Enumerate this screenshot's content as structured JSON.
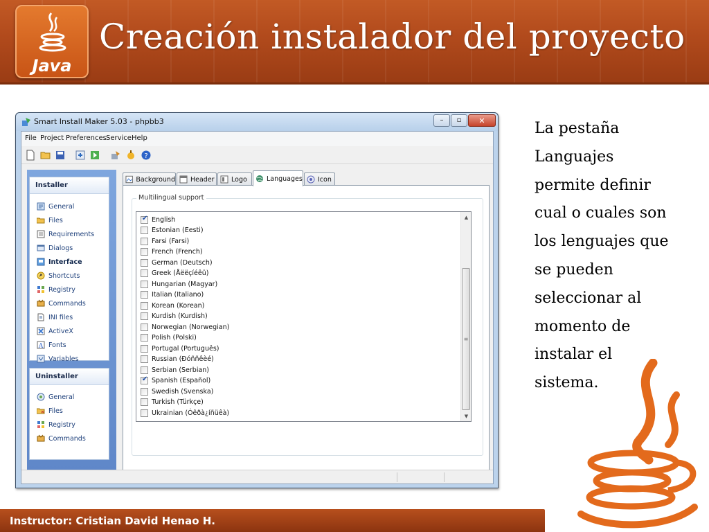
{
  "slide": {
    "title": "Creación instalador del proyecto",
    "logo_text": "Java",
    "footer": "Instructor: Cristian David Henao H.",
    "description_lines": [
      "La pestaña",
      "Languajes",
      "permite definir",
      "cual  o cuales son",
      "los lenguajes que",
      "se pueden",
      "seleccionar al",
      "momento de",
      "instalar el",
      "sistema."
    ],
    "colors": {
      "header": "#b14a1c",
      "footer": "#9a3c14",
      "java_orange": "#e36a1c"
    }
  },
  "window": {
    "title": "Smart Install Maker 5.03 - phpbb3",
    "controls": {
      "minimize": "–",
      "maximize": "▫",
      "close": "✕"
    },
    "menu": [
      "File",
      "Project",
      "Preferences",
      "Service",
      "Help"
    ],
    "toolbar_icons": [
      "new-file-icon",
      "open-folder-icon",
      "save-icon",
      "build-icon",
      "run-icon",
      "settings-icon",
      "wizard-icon",
      "help-icon"
    ],
    "installer": {
      "heading": "Installer",
      "items": [
        "General",
        "Files",
        "Requirements",
        "Dialogs",
        "Interface",
        "Shortcuts",
        "Registry",
        "Commands",
        "INI files",
        "ActiveX",
        "Fonts",
        "Variables"
      ],
      "active": "Interface"
    },
    "uninstaller": {
      "heading": "Uninstaller",
      "items": [
        "General",
        "Files",
        "Registry",
        "Commands"
      ]
    },
    "tabs": [
      "Background",
      "Header",
      "Logo",
      "Languages",
      "Icon"
    ],
    "active_tab": "Languages",
    "group_label": "Multilingual support",
    "languages": [
      {
        "name": "English",
        "checked": true
      },
      {
        "name": "Estonian (Eesti)",
        "checked": false
      },
      {
        "name": "Farsi (Farsi)",
        "checked": false
      },
      {
        "name": "French (French)",
        "checked": false
      },
      {
        "name": "German (Deutsch)",
        "checked": false
      },
      {
        "name": "Greek (Åëëçíéêü)",
        "checked": false
      },
      {
        "name": "Hungarian (Magyar)",
        "checked": false
      },
      {
        "name": "Italian (Italiano)",
        "checked": false
      },
      {
        "name": "Korean (Korean)",
        "checked": false
      },
      {
        "name": "Kurdish (Kurdish)",
        "checked": false
      },
      {
        "name": "Norwegian (Norwegian)",
        "checked": false
      },
      {
        "name": "Polish (Polski)",
        "checked": false
      },
      {
        "name": "Portugal (Português)",
        "checked": false
      },
      {
        "name": "Russian (Ðóññêèé)",
        "checked": false
      },
      {
        "name": "Serbian (Serbian)",
        "checked": false
      },
      {
        "name": "Spanish (Español)",
        "checked": true
      },
      {
        "name": "Swedish (Svenska)",
        "checked": false
      },
      {
        "name": "Turkish (Türkçe)",
        "checked": false
      },
      {
        "name": "Ukrainian (Óêðà¿íñüêà)",
        "checked": false
      }
    ],
    "scrollbar": {
      "up": "▲",
      "down": "▼",
      "grip": "≡"
    }
  }
}
